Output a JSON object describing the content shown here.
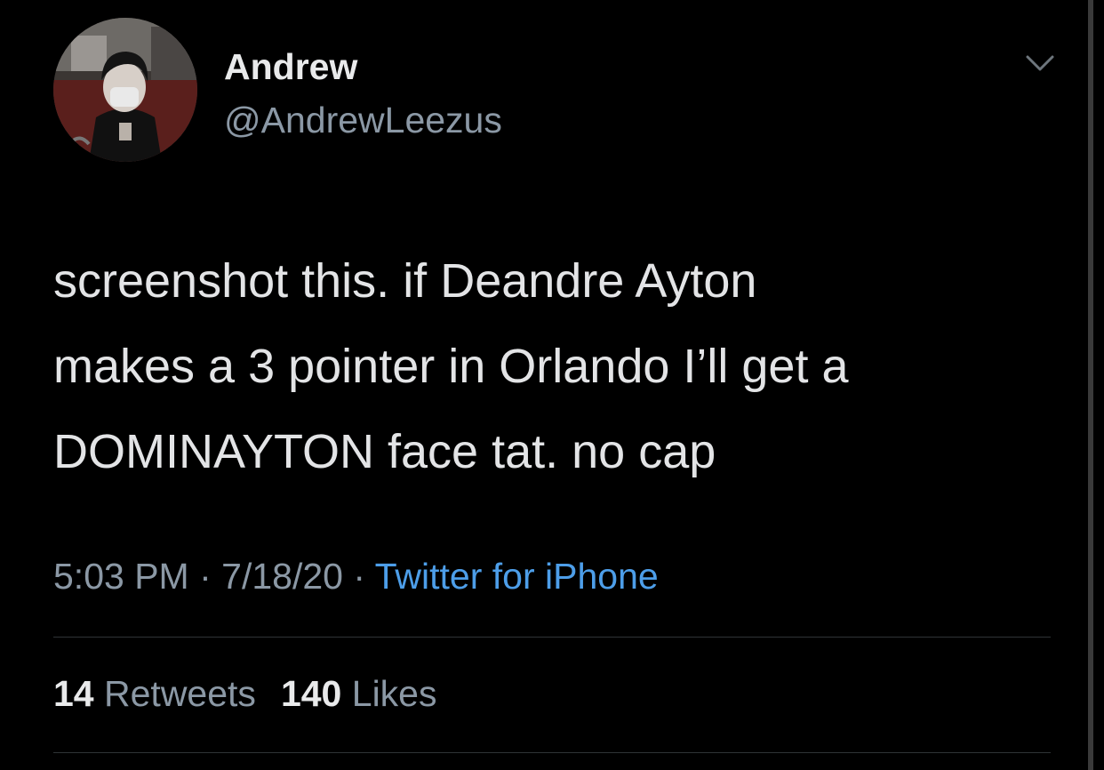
{
  "author": {
    "display_name": "Andrew",
    "handle": "@AndrewLeezus",
    "avatar_icon": "profile-photo"
  },
  "tweet": {
    "text": "screenshot this. if Deandre Ayton\nmakes a 3 pointer in Orlando I’ll get a\nDOMINAYTON face tat. no cap",
    "time": "5:03 PM",
    "separator": " · ",
    "date": "7/18/20",
    "source": "Twitter for iPhone"
  },
  "stats": {
    "retweets_count": "14",
    "retweets_label": "Retweets",
    "likes_count": "140",
    "likes_label": "Likes"
  },
  "colors": {
    "background": "#000000",
    "primary_text": "#e9eaeb",
    "secondary_text": "#8b98a5",
    "link": "#4d9ee9",
    "divider": "#2f3336"
  },
  "icons": {
    "more": "chevron-down-icon"
  }
}
